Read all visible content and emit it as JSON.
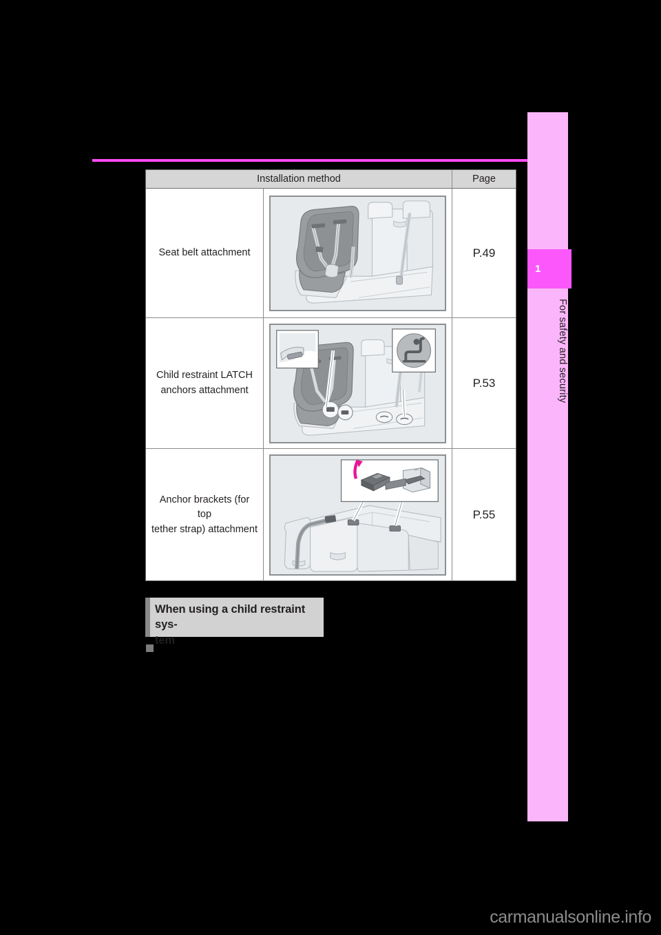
{
  "page": {
    "background_color": "#000000",
    "accent_color": "#fb4cf6"
  },
  "side_tab": {
    "chapter_number": "1",
    "chapter_label": "For safety and security",
    "tab_color": "#fbb6fb",
    "number_box_color": "#fb57fb"
  },
  "table": {
    "headers": {
      "method": "Installation method",
      "page": "Page"
    },
    "rows": [
      {
        "label": "Seat belt attachment",
        "figure_name": "child-seat-belt-attachment-illustration",
        "page": "P.49"
      },
      {
        "label": "Child restraint LATCH anchors attachment",
        "label_line1": "Child restraint LATCH",
        "label_line2": "anchors attachment",
        "figure_name": "child-restraint-latch-anchors-illustration",
        "page": "P.53"
      },
      {
        "label": "Anchor brackets (for top tether strap) attachment",
        "label_line1": "Anchor brackets (for top",
        "label_line2": "tether strap) attachment",
        "figure_name": "anchor-brackets-top-tether-illustration",
        "page": "P.55"
      }
    ]
  },
  "section": {
    "heading": "When using a child restraint system",
    "heading_line1": "When using a child restraint sys-",
    "heading_line2": "tem"
  },
  "footer": {
    "watermark": "carmanualsonline.info"
  }
}
